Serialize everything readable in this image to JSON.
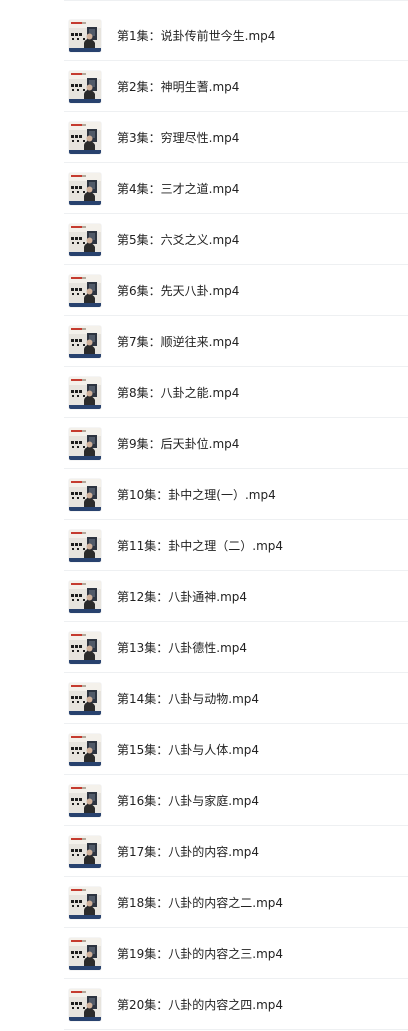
{
  "file_list": {
    "items": [
      {
        "name": "第1集：说卦传前世今生.mp4",
        "thumb": "lecture-video-thumbnail"
      },
      {
        "name": "第2集：神明生蓍.mp4",
        "thumb": "lecture-video-thumbnail"
      },
      {
        "name": "第3集：穷理尽性.mp4",
        "thumb": "lecture-video-thumbnail"
      },
      {
        "name": "第4集：三才之道.mp4",
        "thumb": "lecture-video-thumbnail"
      },
      {
        "name": "第5集：六爻之义.mp4",
        "thumb": "lecture-video-thumbnail"
      },
      {
        "name": "第6集：先天八卦.mp4",
        "thumb": "lecture-video-thumbnail"
      },
      {
        "name": "第7集：顺逆往来.mp4",
        "thumb": "lecture-video-thumbnail"
      },
      {
        "name": "第8集：八卦之能.mp4",
        "thumb": "lecture-video-thumbnail"
      },
      {
        "name": "第9集：后天卦位.mp4",
        "thumb": "lecture-video-thumbnail"
      },
      {
        "name": "第10集：卦中之理(一）.mp4",
        "thumb": "lecture-video-thumbnail"
      },
      {
        "name": "第11集：卦中之理（二）.mp4",
        "thumb": "lecture-video-thumbnail"
      },
      {
        "name": "第12集：八卦通神.mp4",
        "thumb": "lecture-video-thumbnail"
      },
      {
        "name": "第13集：八卦德性.mp4",
        "thumb": "lecture-video-thumbnail"
      },
      {
        "name": "第14集：八卦与动物.mp4",
        "thumb": "lecture-video-thumbnail"
      },
      {
        "name": "第15集：八卦与人体.mp4",
        "thumb": "lecture-video-thumbnail"
      },
      {
        "name": "第16集：八卦与家庭.mp4",
        "thumb": "lecture-video-thumbnail"
      },
      {
        "name": "第17集：八卦的内容.mp4",
        "thumb": "lecture-video-thumbnail"
      },
      {
        "name": "第18集：八卦的内容之二.mp4",
        "thumb": "lecture-video-thumbnail"
      },
      {
        "name": "第19集：八卦的内容之三.mp4",
        "thumb": "lecture-video-thumbnail"
      },
      {
        "name": "第20集：八卦的内容之四.mp4",
        "thumb": "lecture-video-thumbnail"
      }
    ]
  },
  "colors": {
    "thumb_background": "#e7e4de",
    "thumb_screen": "#2d3440",
    "thumb_accent": "#c53b2f",
    "thumb_bottom_bar": "#28426e",
    "divider": "#eef0f2"
  }
}
